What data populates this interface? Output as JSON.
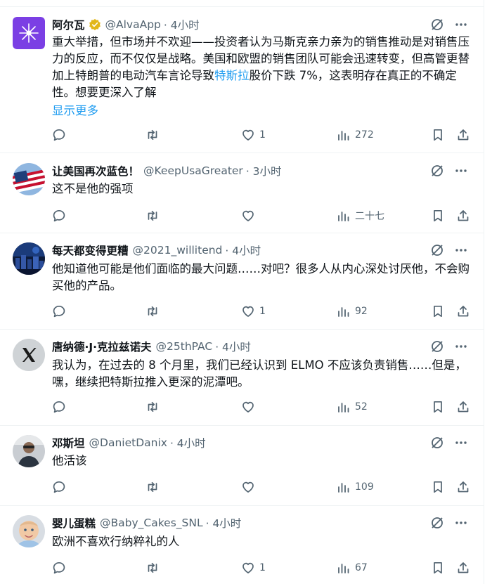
{
  "tweets": [
    {
      "author": "阿尔瓦",
      "handle": "@AlvaApp",
      "time": "· 4小时",
      "verified": true,
      "avatar_icon": "alva-logo-icon",
      "text_parts": [
        "重大举措，但市场并不欢迎——投资者认为马斯克亲力亲为的销售推动是对销售压力的反应，而不仅仅是战略。美国和欧盟的销售团队可能会迅速转变，但高管更替加上特朗普的电动汽车言论导致",
        "特斯拉",
        "股价下跌 7%，这表明存在真正的不确定性。想要更深入了解"
      ],
      "show_more": "显示更多",
      "likes": "1",
      "views": "272"
    },
    {
      "author": "让美国再次蓝色！",
      "handle": "@KeepUsaGreater",
      "time": "· 3小时",
      "avatar_icon": "us-flag-icon",
      "text": "这不是他的强项",
      "likes": "",
      "views": "二十七"
    },
    {
      "author": "每天都变得更糟",
      "handle": "@2021_willitend",
      "time": "· 4小时",
      "avatar_icon": "city-night-icon",
      "text": "他知道他可能是他们面临的最大问题……对吧？很多人从内心深处讨厌他，不会购买他的产品。",
      "likes": "1",
      "views": "92"
    },
    {
      "author": "唐纳德·J·克拉兹诺夫",
      "handle": "@25thPAC",
      "time": "· 4小时",
      "avatar_icon": "x-logo-icon",
      "text": "我认为，在过去的 8 个月里，我们已经认识到 ELMO 不应该负责销售……但是，嘿，继续把特斯拉推入更深的泥潭吧。",
      "likes": "",
      "views": "52"
    },
    {
      "author": "邓斯坦",
      "handle": "@DanietDanix",
      "time": "· 4小时",
      "avatar_icon": "person-photo-icon",
      "text": "他活该",
      "likes": "",
      "views": "109"
    },
    {
      "author": "婴儿蛋糕",
      "handle": "@Baby_Cakes_SNL",
      "time": "· 4小时",
      "avatar_icon": "baby-photo-icon",
      "text": "欧洲不喜欢行纳粹礼的人",
      "likes": "1",
      "views": "67"
    }
  ],
  "colors": {
    "text": "#0f1419",
    "secondary": "#536471",
    "link": "#1d9bf0",
    "divider": "#eff3f4",
    "verified_gold": "#e2b719"
  }
}
